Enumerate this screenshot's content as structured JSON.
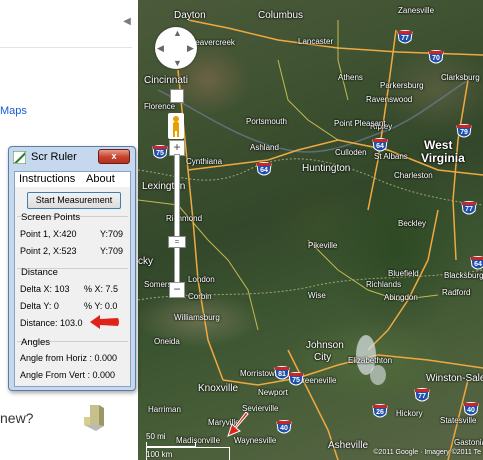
{
  "page": {
    "maps_link": "Maps",
    "new_text": "new?"
  },
  "map": {
    "cities": [
      {
        "name": "Dayton"
      },
      {
        "name": "Columbus"
      },
      {
        "name": "Zanesville"
      },
      {
        "name": "Beavercreek"
      },
      {
        "name": "Lancaster"
      },
      {
        "name": "Cincinnati"
      },
      {
        "name": "Athens"
      },
      {
        "name": "Parkersburg"
      },
      {
        "name": "Clarksburg"
      },
      {
        "name": "Florence"
      },
      {
        "name": "Portsmouth"
      },
      {
        "name": "Ravenswood"
      },
      {
        "name": "Ripley"
      },
      {
        "name": "Point Pleasant"
      },
      {
        "name": "West"
      },
      {
        "name": "Virginia"
      },
      {
        "name": "Ashland"
      },
      {
        "name": "Culloden"
      },
      {
        "name": "St Albans"
      },
      {
        "name": "Huntington"
      },
      {
        "name": "Charleston"
      },
      {
        "name": "Cynthiana"
      },
      {
        "name": "Lexington"
      },
      {
        "name": "Beckley"
      },
      {
        "name": "Richmond"
      },
      {
        "name": "Pikeville"
      },
      {
        "name": "Bluefield"
      },
      {
        "name": "Blacksburg"
      },
      {
        "name": "Richlands"
      },
      {
        "name": "Radford"
      },
      {
        "name": "London"
      },
      {
        "name": "Wise"
      },
      {
        "name": "Abingdon"
      },
      {
        "name": "Corbin"
      },
      {
        "name": "Williamsburg"
      },
      {
        "name": "Johnson"
      },
      {
        "name": "City"
      },
      {
        "name": "Elizabethton"
      },
      {
        "name": "Oneida"
      },
      {
        "name": "Morristown"
      },
      {
        "name": "Greeneville"
      },
      {
        "name": "Winston-Sale"
      },
      {
        "name": "Knoxville"
      },
      {
        "name": "Newport"
      },
      {
        "name": "Sevierville"
      },
      {
        "name": "Hickory"
      },
      {
        "name": "Harriman"
      },
      {
        "name": "Maryville"
      },
      {
        "name": "Statesville"
      },
      {
        "name": "Madisonville"
      },
      {
        "name": "Waynesville"
      },
      {
        "name": "Asheville"
      },
      {
        "name": "Gastonia"
      },
      {
        "name": "Somerset"
      },
      {
        "name": "cky"
      }
    ],
    "shields": [
      "70",
      "77",
      "79",
      "64",
      "64",
      "75",
      "75",
      "81",
      "40",
      "26",
      "77",
      "40",
      "77",
      "64"
    ],
    "scale_label": "50 mi",
    "scale_label2": "100 km",
    "copyright": "©2011 Google · Imagery ©2011 Te"
  },
  "ruler": {
    "title": "Scr Ruler",
    "close": "x",
    "menu_instructions": "Instructions",
    "menu_about": "About",
    "start_button": "Start Measurement",
    "screen_points_title": "Screen Points",
    "p1_label": "Point 1,  X:420",
    "p1_y": "Y:709",
    "p2_label": "Point 2,  X:523",
    "p2_y": "Y:709",
    "distance_title": "Distance",
    "delta_x": "Delta X: 103",
    "pct_x": "% X: 7.5",
    "delta_y": "Delta Y: 0",
    "pct_y": "% Y: 0.0",
    "distance": "Distance: 103.0",
    "angles_title": "Angles",
    "angle_horiz": "Angle from Horiz : 0.000",
    "angle_vert": "Angle From Vert : 0.000"
  },
  "colors": {
    "accent_red": "#e0231a",
    "window_frame": "#c5d8ee",
    "close_red": "#c6402a",
    "link_blue": "#1a5bd8"
  }
}
